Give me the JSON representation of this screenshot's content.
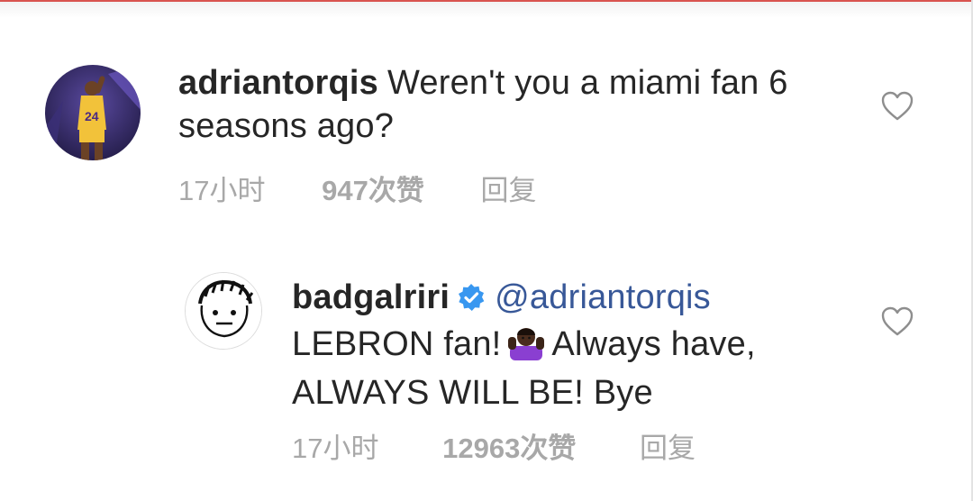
{
  "comments": [
    {
      "username": "adriantorqis",
      "text_line1": "Weren't you a miami fan 6",
      "text_line2": "seasons ago?",
      "time": "17小时",
      "likes": "947次赞",
      "reply_label": "回复"
    },
    {
      "username": "badgalriri",
      "verified": true,
      "mention": "@adriantorqis",
      "text_part1": "LEBRON fan!",
      "emoji": "woman-shrugging-emoji",
      "text_part2": "Always have,",
      "text_line2": "ALWAYS WILL BE! Bye",
      "time": "17小时",
      "likes": "12963次赞",
      "reply_label": "回复"
    }
  ],
  "colors": {
    "text": "#262626",
    "meta": "#a8a8a8",
    "mention": "#385898",
    "verified": "#3897f0",
    "top_rule": "#d9534f"
  }
}
